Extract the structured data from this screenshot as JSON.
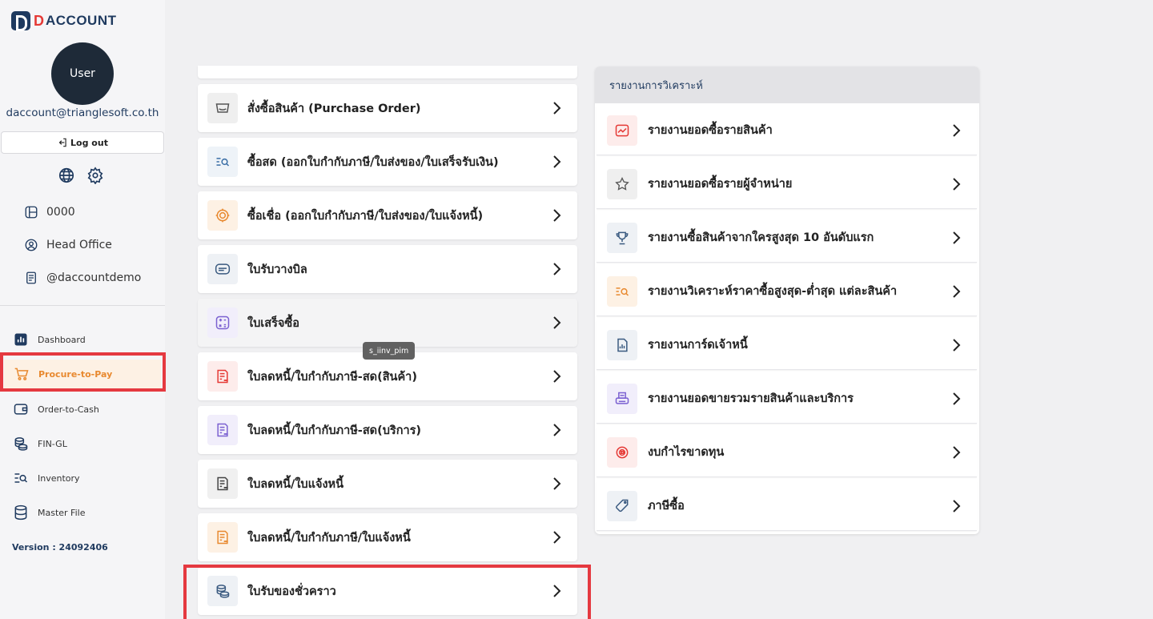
{
  "app": {
    "logo_d": "D",
    "logo_text": "ACCOUNT",
    "user_label": "User",
    "email": "daccount@trianglesoft.co.th",
    "logout_label": "Log out",
    "company_code": "0000",
    "branch": "Head Office",
    "username": "@daccountdemo",
    "version": "Version : 24092406"
  },
  "nav": [
    {
      "label": "Dashboard",
      "icon": "bar-chart-icon"
    },
    {
      "label": "Procure-to-Pay",
      "icon": "cart-icon",
      "active": true
    },
    {
      "label": "Order-to-Cash",
      "icon": "wallet-icon"
    },
    {
      "label": "FIN-GL",
      "icon": "coins-icon"
    },
    {
      "label": "Inventory",
      "icon": "list-search-icon"
    },
    {
      "label": "Master File",
      "icon": "database-icon"
    }
  ],
  "menu": [
    {
      "label": "สั่งซื้อสินค้า (Purchase Order)",
      "icon": "box-icon",
      "color": "#555555",
      "bg": "#efefef"
    },
    {
      "label": "ซื้อสด (ออกใบกำกับภาษี/ใบส่งของ/ใบเสร็จรับเงิน)",
      "icon": "list-search-icon",
      "color": "#3a6ea5",
      "bg": "#eef3f8"
    },
    {
      "label": "ซื้อเชื่อ (ออกใบกำกับภาษี/ใบส่งของ/ใบแจ้งหนี้)",
      "icon": "badge-icon",
      "color": "#e8892f",
      "bg": "#fdf1e4"
    },
    {
      "label": "ใบรับวางบิล",
      "icon": "card-icon",
      "color": "#3a5a80",
      "bg": "#eef1f5"
    },
    {
      "label": "ใบเสร็จซื้อ",
      "icon": "calculator-icon",
      "color": "#7b61d1",
      "bg": "#f1eefb"
    },
    {
      "label": "ใบลดหนี้/ใบกำกับภาษี-สด(สินค้า)",
      "icon": "doc-icon",
      "color": "#e53935",
      "bg": "#fdeceb"
    },
    {
      "label": "ใบลดหนี้/ใบกำกับภาษี-สด(บริการ)",
      "icon": "doc-icon",
      "color": "#7b61d1",
      "bg": "#f1eefb"
    },
    {
      "label": "ใบลดหนี้/ใบแจ้งหนี้",
      "icon": "doc-icon",
      "color": "#444444",
      "bg": "#f0f0f0"
    },
    {
      "label": "ใบลดหนี้/ใบกำกับภาษี/ใบแจ้งหนี้",
      "icon": "doc-icon",
      "color": "#e8892f",
      "bg": "#fdf1e4"
    },
    {
      "label": "ใบรับของชั่วคราว",
      "icon": "coins-icon",
      "color": "#3a5a80",
      "bg": "#eef1f5"
    }
  ],
  "tooltip": "s_iinv_pim",
  "reports": {
    "title": "รายงานการวิเคราะห์",
    "items": [
      {
        "label": "รายงานยอดซื้อรายสินค้า",
        "icon": "trend-icon",
        "color": "#e53935",
        "bg": "#fdeceb"
      },
      {
        "label": "รายงานยอดซื้อรายผู้จำหน่าย",
        "icon": "star-icon",
        "color": "#555555",
        "bg": "#efefef"
      },
      {
        "label": "รายงานซื้อสินค้าจากใครสูงสุด 10 อันดับแรก",
        "icon": "trophy-icon",
        "color": "#3a5a80",
        "bg": "#eef1f5"
      },
      {
        "label": "รายงานวิเคราะห์ราคาซื้อสูงสุด-ต่ำสุด แต่ละสินค้า",
        "icon": "list-search-icon",
        "color": "#e8892f",
        "bg": "#fdf1e4"
      },
      {
        "label": "รายงานการ์ดเจ้าหนี้",
        "icon": "report-icon",
        "color": "#3a5a80",
        "bg": "#eef1f5"
      },
      {
        "label": "รายงานยอดขายรวมรายสินค้าและบริการ",
        "icon": "printer-icon",
        "color": "#7b61d1",
        "bg": "#f1eefb"
      },
      {
        "label": "งบกำไรขาดทุน",
        "icon": "coin-stack-icon",
        "color": "#e53935",
        "bg": "#fdeceb"
      },
      {
        "label": "ภาษีซื้อ",
        "icon": "tag-icon",
        "color": "#3a5a80",
        "bg": "#eef1f5"
      }
    ]
  }
}
